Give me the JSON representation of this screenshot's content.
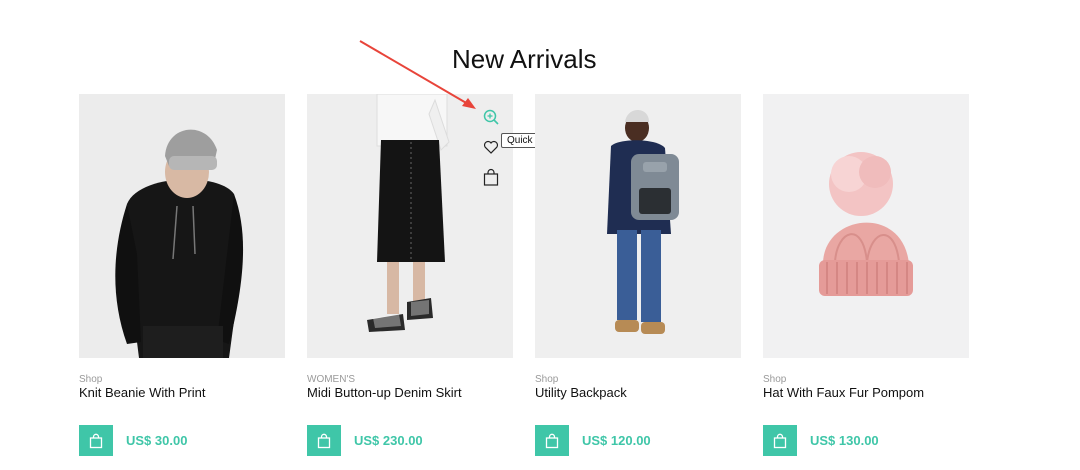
{
  "section": {
    "title": "New Arrivals"
  },
  "products": [
    {
      "category": "Shop",
      "title": "Knit Beanie With Print",
      "price": "US$ 30.00",
      "image": "boy-in-black-hoodie-and-grey-beanie"
    },
    {
      "category": "WOMEN'S",
      "title": "Midi Button-up Denim Skirt",
      "price": "US$ 230.00",
      "image": "black-denim-skirt-with-checkered-sneakers"
    },
    {
      "category": "Shop",
      "title": "Utility Backpack",
      "price": "US$ 120.00",
      "image": "boy-with-grey-backpack-back-view"
    },
    {
      "category": "Shop",
      "title": "Hat With Faux Fur Pompom",
      "price": "US$ 130.00",
      "image": "pink-knit-hat-with-pompom"
    }
  ],
  "hover_actions": {
    "tooltip": "Quick View",
    "icons": [
      "quick-view-icon",
      "wishlist-icon",
      "add-to-cart-icon"
    ]
  },
  "cart_icon": "shopping-bag-icon",
  "colors": {
    "accent": "#3fc6a8",
    "arrow": "#e8443a",
    "image_bg": "#eeeeee"
  }
}
